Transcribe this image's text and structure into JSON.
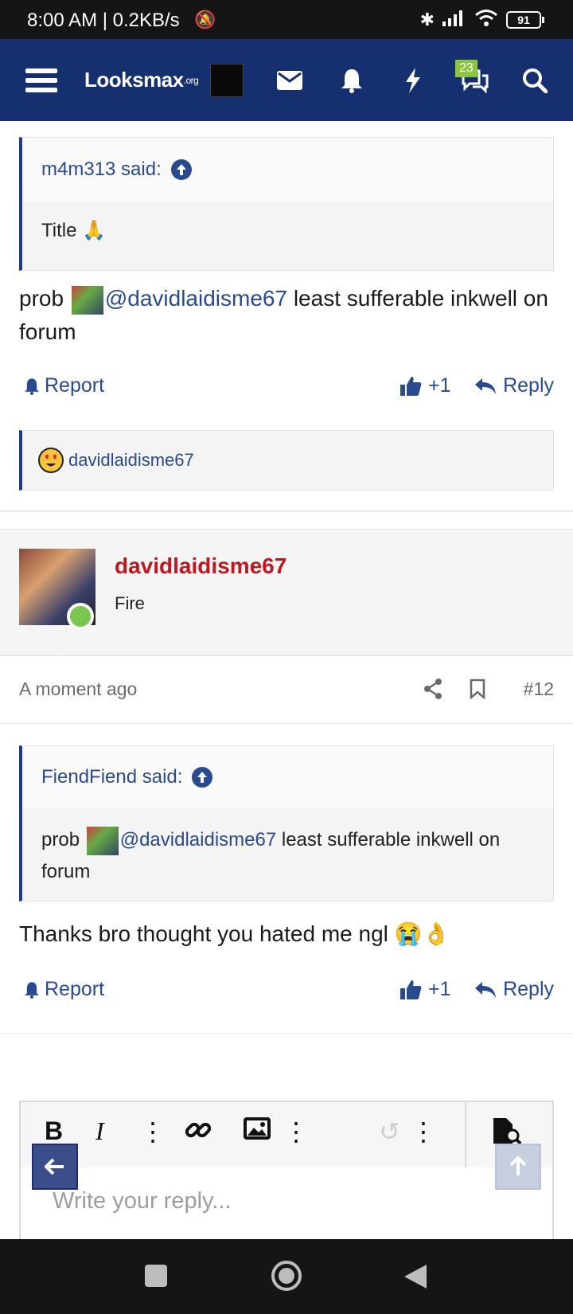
{
  "status_bar": {
    "time": "8:00 AM | 0.2KB/s",
    "battery": "91"
  },
  "nav": {
    "logo": "Looksmax",
    "logo_suffix": ".org",
    "notification_count": "23"
  },
  "post_11": {
    "quote_author": "m4m313 said:",
    "quote_text": "Title 🙏",
    "text_before": "prob",
    "mention": "@davidlaidisme67",
    "text_after": " least sufferable inkwell on forum",
    "report_label": "Report",
    "like_label": "+1",
    "reply_label": "Reply",
    "reaction_user": "davidlaidisme67"
  },
  "post_12": {
    "username": "davidlaidisme67",
    "user_title": "Fire",
    "time": "A moment ago",
    "post_number": "#12",
    "quote_author": "FiendFiend said:",
    "quote_before": "prob",
    "quote_mention": "@davidlaidisme67",
    "quote_after": " least sufferable inkwell on forum",
    "text": "Thanks bro thought you hated me ngl 😭👌",
    "report_label": "Report",
    "like_label": "+1",
    "reply_label": "Reply"
  },
  "editor": {
    "placeholder": "Write your reply..."
  },
  "colors": {
    "nav_bg": "#162f6f",
    "link": "#2a4a8f",
    "username": "#c0161d",
    "online": "#7ac74f"
  }
}
